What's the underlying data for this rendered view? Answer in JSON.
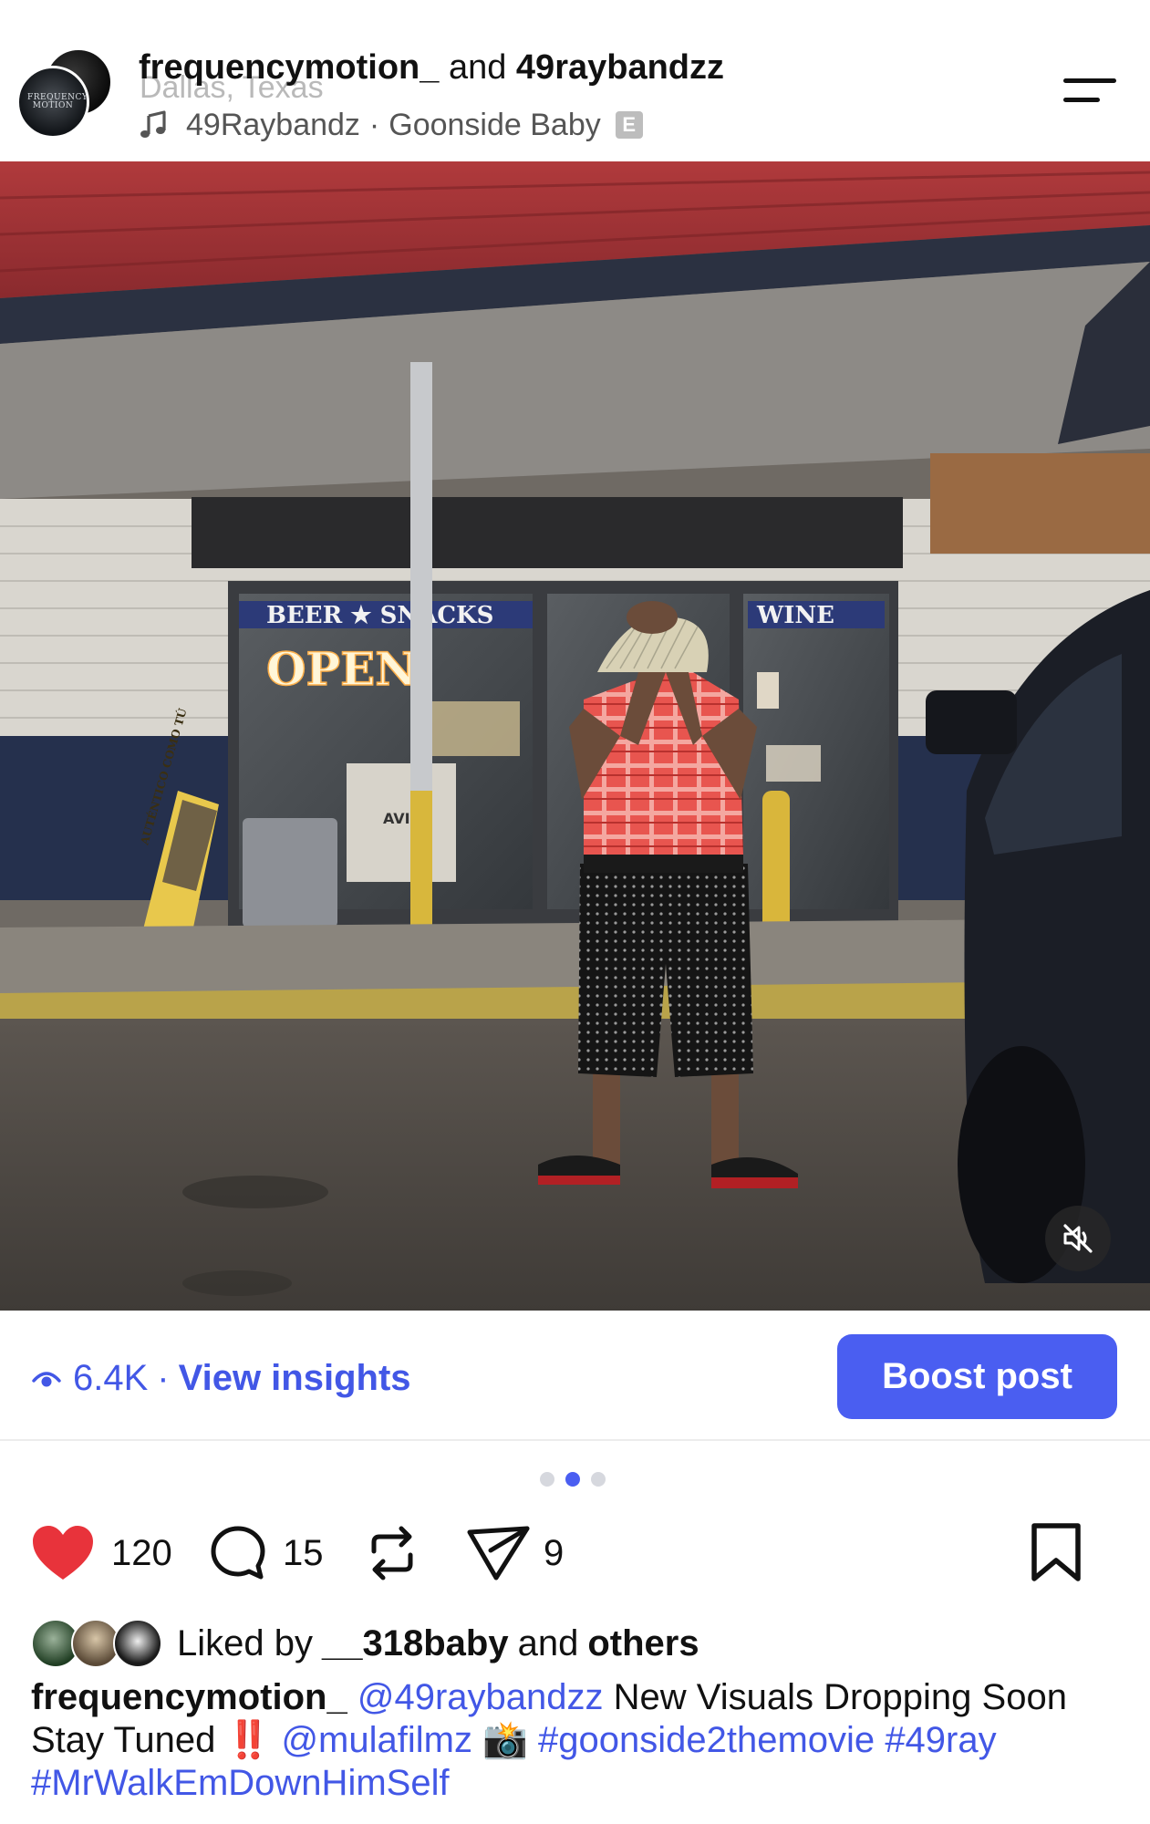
{
  "header": {
    "avatar_text": "FREQUENCY MOTION",
    "author": "frequencymotion_",
    "conjunction": "and",
    "collaborator": "49raybandzz",
    "location": "Dallas, Texas",
    "audio_artist": "49Raybandz",
    "audio_separator": "·",
    "audio_track": "Goonside Baby",
    "explicit_badge": "E"
  },
  "photo": {
    "sign_beer_snacks": "BEER ★ SNACKS",
    "sign_open": "OPEN",
    "sign_wine": "WINE",
    "sign_aviso": "AVISO",
    "standee_text": "AUTÉNTICO COMO TÚ",
    "mute_icon": "muted-speaker-icon"
  },
  "insights": {
    "views": "6.4K",
    "separator": "·",
    "link_label": "View insights",
    "boost_label": "Boost post"
  },
  "carousel": {
    "total": 3,
    "active_index": 1
  },
  "actions": {
    "likes": "120",
    "comments": "15",
    "shares": "9"
  },
  "likes": {
    "prefix": "Liked by",
    "user": "__318baby",
    "middle": "and",
    "suffix": "others"
  },
  "caption": {
    "user": "frequencymotion_",
    "mention1": "@49raybandzz",
    "text1": "New Visuals Dropping Soon Stay Tuned",
    "emoji1": "‼️",
    "mention2": "@mulafilmz",
    "emoji2": "📸",
    "hashtag1": "#goonside2themovie",
    "hashtag2": "#49ray",
    "hashtag3": "#MrWalkEmDownHimSelf"
  },
  "colors": {
    "accent": "#4a5ef1",
    "link": "#4257e6",
    "heart": "#e8333b"
  }
}
